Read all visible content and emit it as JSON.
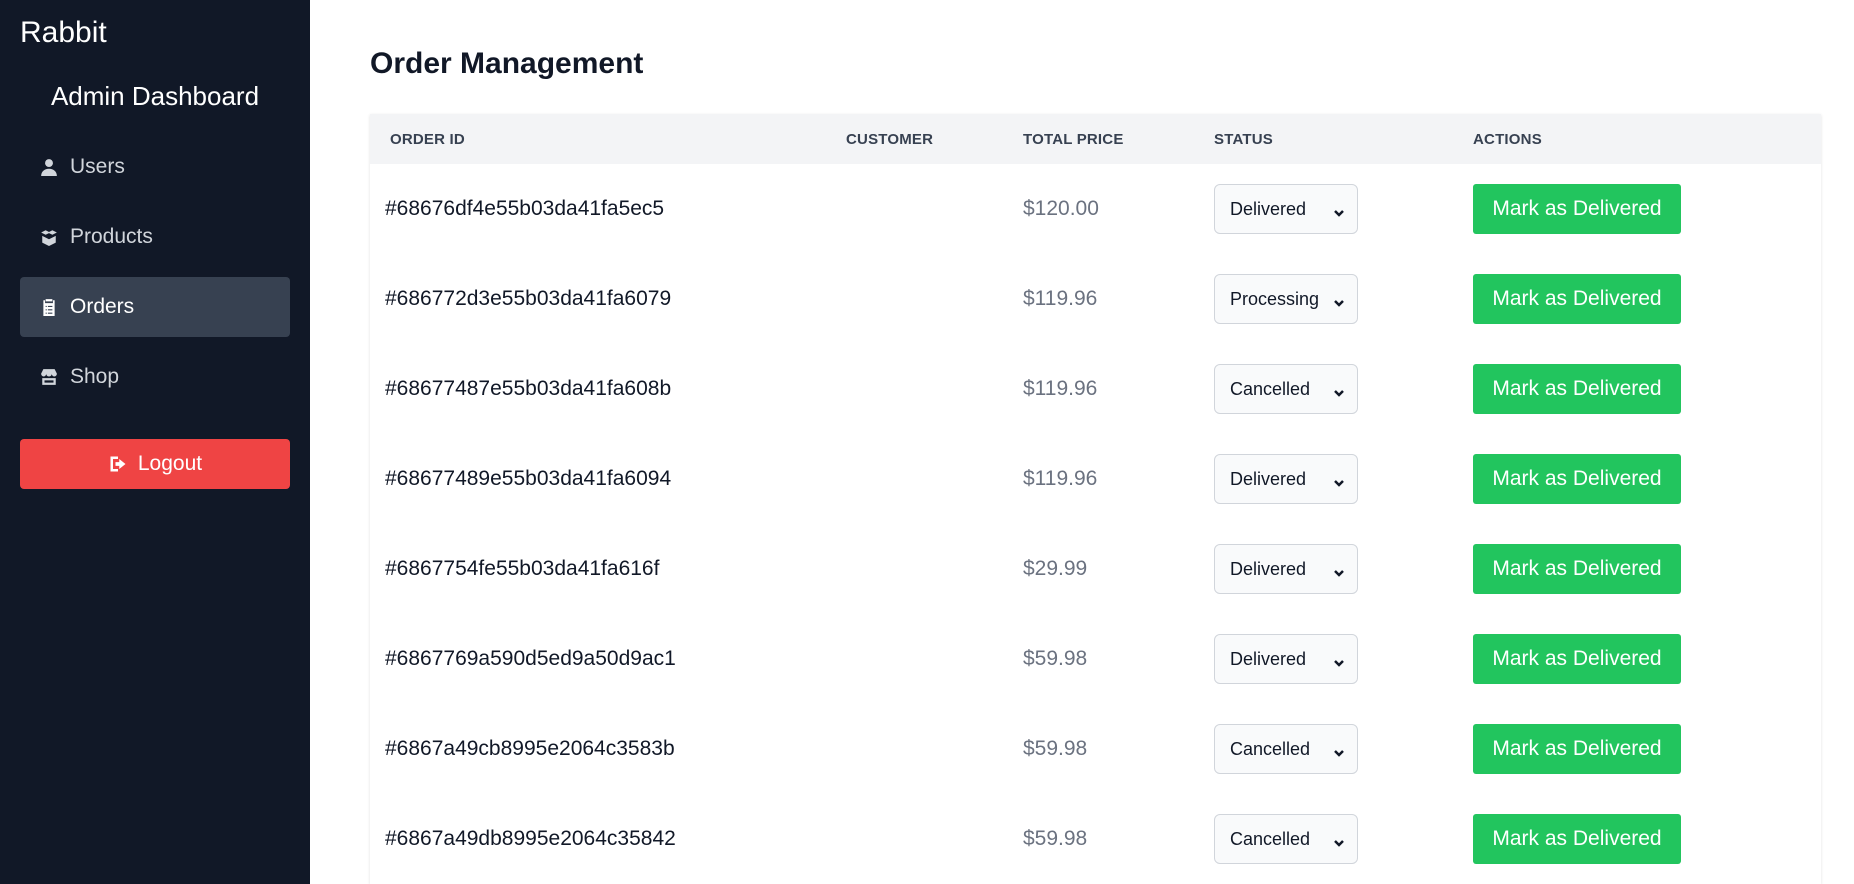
{
  "sidebar": {
    "brand": "Rabbit",
    "title": "Admin Dashboard",
    "items": [
      {
        "label": "Users",
        "icon": "user-icon",
        "active": false
      },
      {
        "label": "Products",
        "icon": "boxes-icon",
        "active": false
      },
      {
        "label": "Orders",
        "icon": "clipboard-icon",
        "active": true
      },
      {
        "label": "Shop",
        "icon": "store-icon",
        "active": false
      }
    ],
    "logout_label": "Logout"
  },
  "main": {
    "title": "Order Management",
    "columns": [
      "ORDER ID",
      "CUSTOMER",
      "TOTAL PRICE",
      "STATUS",
      "ACTIONS"
    ],
    "action_label": "Mark as Delivered",
    "orders": [
      {
        "id": "#68676df4e55b03da41fa5ec5",
        "customer": "",
        "total": "$120.00",
        "status": "Delivered"
      },
      {
        "id": "#686772d3e55b03da41fa6079",
        "customer": "",
        "total": "$119.96",
        "status": "Processing"
      },
      {
        "id": "#68677487e55b03da41fa608b",
        "customer": "",
        "total": "$119.96",
        "status": "Cancelled"
      },
      {
        "id": "#68677489e55b03da41fa6094",
        "customer": "",
        "total": "$119.96",
        "status": "Delivered"
      },
      {
        "id": "#6867754fe55b03da41fa616f",
        "customer": "",
        "total": "$29.99",
        "status": "Delivered"
      },
      {
        "id": "#6867769a590d5ed9a50d9ac1",
        "customer": "",
        "total": "$59.98",
        "status": "Delivered"
      },
      {
        "id": "#6867a49cb8995e2064c3583b",
        "customer": "",
        "total": "$59.98",
        "status": "Cancelled"
      },
      {
        "id": "#6867a49db8995e2064c35842",
        "customer": "",
        "total": "$59.98",
        "status": "Cancelled"
      }
    ]
  },
  "colors": {
    "sidebar_bg": "#111827",
    "active_item_bg": "#374151",
    "logout_bg": "#ef4444",
    "action_bg": "#22c55e",
    "header_bg": "#f3f4f6"
  }
}
